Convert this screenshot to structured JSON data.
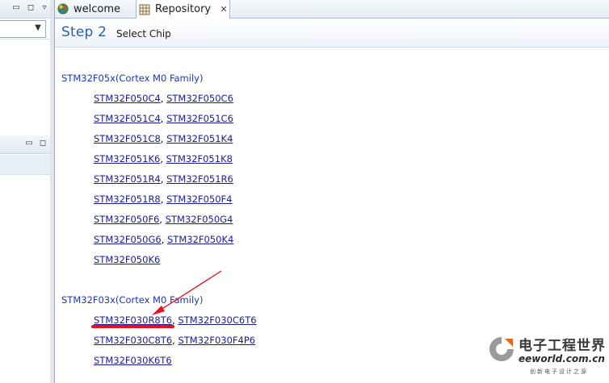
{
  "tabs": [
    {
      "label": "welcome",
      "icon": "welcome-globe-icon"
    },
    {
      "label": "Repository",
      "icon": "grid-table-icon",
      "active": true
    }
  ],
  "step": {
    "title": "Step 2",
    "subtitle": "Select Chip"
  },
  "families": [
    {
      "name": "STM32F05x(Cortex M0 Family)",
      "rows": [
        [
          "STM32F050C4",
          "STM32F050C6"
        ],
        [
          "STM32F051C4",
          "STM32F051C6"
        ],
        [
          "STM32F051C8",
          "STM32F051K4"
        ],
        [
          "STM32F051K6",
          "STM32F051K8"
        ],
        [
          "STM32F051R4",
          "STM32F051R6"
        ],
        [
          "STM32F051R8",
          "STM32F050F4"
        ],
        [
          "STM32F050F6",
          "STM32F050G4"
        ],
        [
          "STM32F050G6",
          "STM32F050K4"
        ],
        [
          "STM32F050K6"
        ]
      ]
    },
    {
      "name": "STM32F03x(Cortex M0 Family)",
      "rows": [
        [
          "STM32F030R8T6",
          "STM32F030C6T6"
        ],
        [
          "STM32F030C8T6",
          "STM32F030F4P6"
        ],
        [
          "STM32F030K6T6"
        ]
      ]
    }
  ],
  "separator": ",",
  "colors": {
    "family_title": "#1f35b8",
    "chip_link": "#1b1b99",
    "step_title": "#2a5ea8",
    "annotation_red": "#e8101a"
  },
  "watermark": {
    "cn": "电子工程世界",
    "url": "eeworld.com.cn",
    "tagline": "创新电子设计之源"
  }
}
